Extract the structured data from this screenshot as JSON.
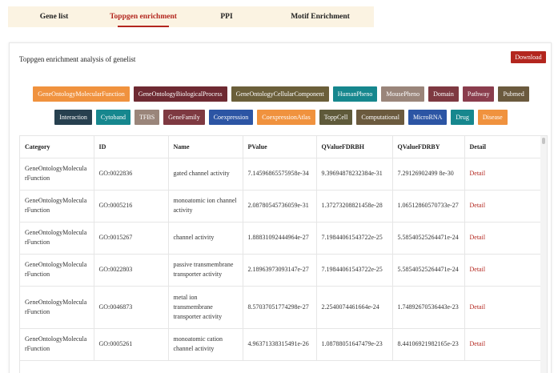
{
  "tabs": [
    {
      "label": "Gene list"
    },
    {
      "label": "Toppgen enrichment"
    },
    {
      "label": "PPI"
    },
    {
      "label": "Motif Enrichment"
    }
  ],
  "panel": {
    "title": "Toppgen enrichment analysis of genelist",
    "download_label": "Download"
  },
  "tag_rows": [
    [
      {
        "label": "GeneOntologyMolecularFunction",
        "color": "#f0923e"
      },
      {
        "label": "GeneOntologyBiologicalProcess",
        "color": "#6e2a32"
      },
      {
        "label": "GeneOntologyCellularComponent",
        "color": "#6b5f3a"
      },
      {
        "label": "HumanPheno",
        "color": "#16878e"
      },
      {
        "label": "MousePheno",
        "color": "#9a857a"
      },
      {
        "label": "Domain",
        "color": "#7e3941"
      },
      {
        "label": "Pathway",
        "color": "#8a3d4d"
      },
      {
        "label": "Pubmed",
        "color": "#6b5a3e"
      }
    ],
    [
      {
        "label": "Interaction",
        "color": "#27404f"
      },
      {
        "label": "Cytoband",
        "color": "#16878e"
      },
      {
        "label": "TFBS",
        "color": "#9a857a"
      },
      {
        "label": "GeneFamily",
        "color": "#7e3941"
      },
      {
        "label": "Coexpression",
        "color": "#2c55a4"
      },
      {
        "label": "CoexpressionAtlas",
        "color": "#f0923e"
      },
      {
        "label": "ToppCell",
        "color": "#5f5a3a"
      },
      {
        "label": "Computational",
        "color": "#6b5a3e"
      },
      {
        "label": "MicroRNA",
        "color": "#2c55a4"
      },
      {
        "label": "Drug",
        "color": "#16878e"
      },
      {
        "label": "Disease",
        "color": "#f0923e"
      }
    ]
  ],
  "table": {
    "headers": [
      "Category",
      "ID",
      "Name",
      "PValue",
      "QValueFDRBH",
      "QValueFDRBY",
      "Detail"
    ],
    "rows": [
      {
        "category": "GeneOntologyMolecularFunction",
        "id": "GO:0022836",
        "name": "gated channel activity",
        "pvalue": "7.14596865575958e-34",
        "bh": "9.39694878232384e-31",
        "by": "7.29126902499 8e-30",
        "detail": "Detail"
      },
      {
        "category": "GeneOntologyMolecularFunction",
        "id": "GO:0005216",
        "name": "monoatomic ion channel activity",
        "pvalue": "2.08780545736059e-31",
        "bh": "1.37273208821458e-28",
        "by": "1.06512860570733e-27",
        "detail": "Detail"
      },
      {
        "category": "GeneOntologyMolecularFunction",
        "id": "GO:0015267",
        "name": "channel activity",
        "pvalue": "1.88831092444964e-27",
        "bh": "7.19844061543722e-25",
        "by": "5.58540525264471e-24",
        "detail": "Detail"
      },
      {
        "category": "GeneOntologyMolecularFunction",
        "id": "GO:0022803",
        "name": "passive transmembrane transporter activity",
        "pvalue": "2.18963973093147e-27",
        "bh": "7.19844061543722e-25",
        "by": "5.58540525264471e-24",
        "detail": "Detail"
      },
      {
        "category": "GeneOntologyMolecularFunction",
        "id": "GO:0046873",
        "name": "metal ion transmembrane transporter activity",
        "pvalue": "8.57037051774298e-27",
        "bh": "2.2540074461664e-24",
        "by": "1.74892670536443e-23",
        "detail": "Detail"
      },
      {
        "category": "GeneOntologyMolecularFunction",
        "id": "GO:0005261",
        "name": "monoatomic cation channel activity",
        "pvalue": "4.96371338315491e-26",
        "bh": "1.08788051647479e-23",
        "by": "8.44106921982165e-23",
        "detail": "Detail"
      }
    ]
  }
}
